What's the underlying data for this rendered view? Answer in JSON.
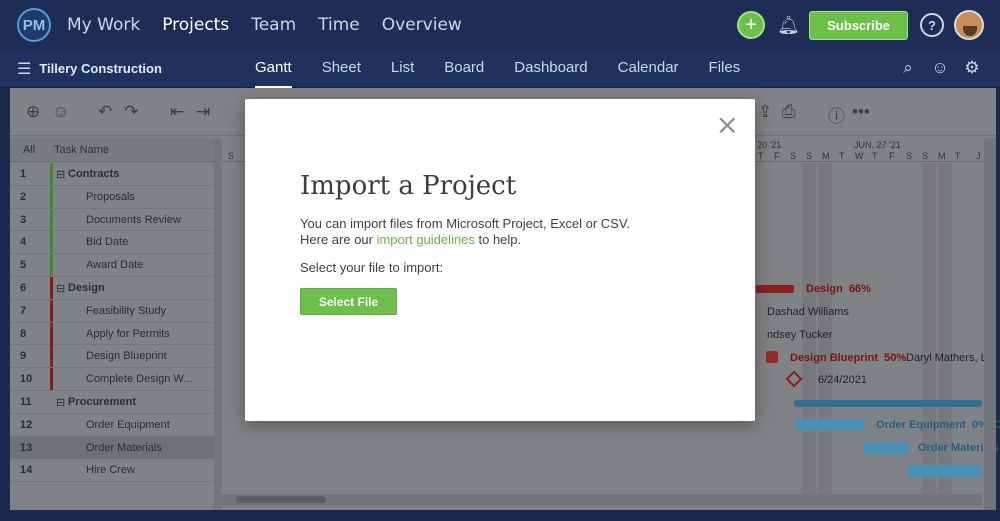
{
  "topbar": {
    "logo": "PM",
    "nav": [
      "My Work",
      "Projects",
      "Team",
      "Time",
      "Overview"
    ],
    "active_nav": "Projects",
    "subscribe_label": "Subscribe",
    "help_label": "?"
  },
  "subbar": {
    "project_name": "Tillery Construction",
    "views": [
      "Gantt",
      "Sheet",
      "List",
      "Board",
      "Dashboard",
      "Calendar",
      "Files"
    ],
    "active_view": "Gantt"
  },
  "grid": {
    "col_all": "All",
    "col_task": "Task Name",
    "rows": [
      {
        "num": "1",
        "name": "Contracts",
        "group": true,
        "color": "#3f8a2a"
      },
      {
        "num": "2",
        "name": "Proposals",
        "group": false,
        "color": "#3f8a2a"
      },
      {
        "num": "3",
        "name": "Documents Review",
        "group": false,
        "color": "#3f8a2a"
      },
      {
        "num": "4",
        "name": "Bid Date",
        "group": false,
        "color": "#3f8a2a"
      },
      {
        "num": "5",
        "name": "Award Date",
        "group": false,
        "color": "#3f8a2a"
      },
      {
        "num": "6",
        "name": "Design",
        "group": true,
        "color": "#8a1a1a"
      },
      {
        "num": "7",
        "name": "Feasibility Study",
        "group": false,
        "color": "#8a1a1a"
      },
      {
        "num": "8",
        "name": "Apply for Permits",
        "group": false,
        "color": "#8a1a1a"
      },
      {
        "num": "9",
        "name": "Design Blueprint",
        "group": false,
        "color": "#8a1a1a"
      },
      {
        "num": "10",
        "name": "Complete Design W...",
        "group": false,
        "color": "#8a1a1a"
      },
      {
        "num": "11",
        "name": "Procurement",
        "group": true,
        "color": ""
      },
      {
        "num": "12",
        "name": "Order Equipment",
        "group": false,
        "color": ""
      },
      {
        "num": "13",
        "name": "Order Materials",
        "group": false,
        "color": ""
      },
      {
        "num": "14",
        "name": "Hire Crew",
        "group": false,
        "color": ""
      }
    ]
  },
  "gantt": {
    "week1_label": "20 '21",
    "week2_label": "JUN, 27 '21",
    "days": [
      "S",
      "T",
      "F",
      "S",
      "S",
      "M",
      "T",
      "W",
      "T",
      "F",
      "S",
      "S",
      "M",
      "T",
      "J"
    ],
    "labels": {
      "design": "Design",
      "design_pct": "66%",
      "dashad": "Dashad Williams",
      "lindsey": "ndsey Tucker",
      "blueprint": "Design Blueprint",
      "blueprint_pct": "50%",
      "daryl": "Daryl Mathers, Lin",
      "milestone_date": "6/24/2021",
      "order_equipment": "Order Equipment",
      "order_equipment_pct": "0%",
      "order_equipment_tail": "C",
      "order_materials": "Order Materials"
    }
  },
  "modal": {
    "title": "Import a Project",
    "line1": "You can import files from Microsoft Project, Excel or CSV.",
    "line2_pre": "Here are our ",
    "line2_link": "import guidelines",
    "line2_post": " to help.",
    "prompt": "Select your file to import:",
    "button": "Select File",
    "close": "×"
  },
  "colors": {
    "accent_green": "#6cbf4a",
    "nav_bg": "#1d2d55",
    "design_red": "#c0392b",
    "procurement_blue": "#3a9fd1"
  }
}
